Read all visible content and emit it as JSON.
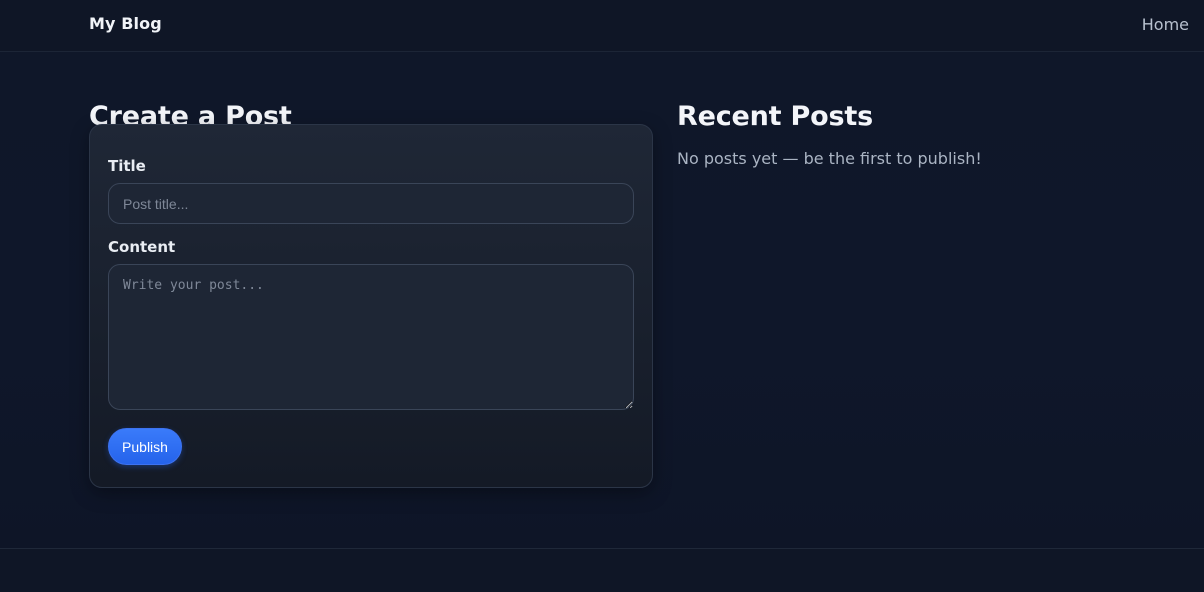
{
  "header": {
    "brand": "My Blog",
    "nav": {
      "home_label": "Home"
    }
  },
  "create": {
    "heading": "Create a Post",
    "title_label": "Title",
    "title_placeholder": "Post title...",
    "title_value": "",
    "content_label": "Content",
    "content_placeholder": "Write your post...",
    "content_value": "",
    "publish_label": "Publish"
  },
  "recent": {
    "heading": "Recent Posts",
    "empty_message": "No posts yet — be the first to publish!"
  },
  "colors": {
    "accent": "#2563eb",
    "background": "#0f172a",
    "card": "#1e2635"
  }
}
